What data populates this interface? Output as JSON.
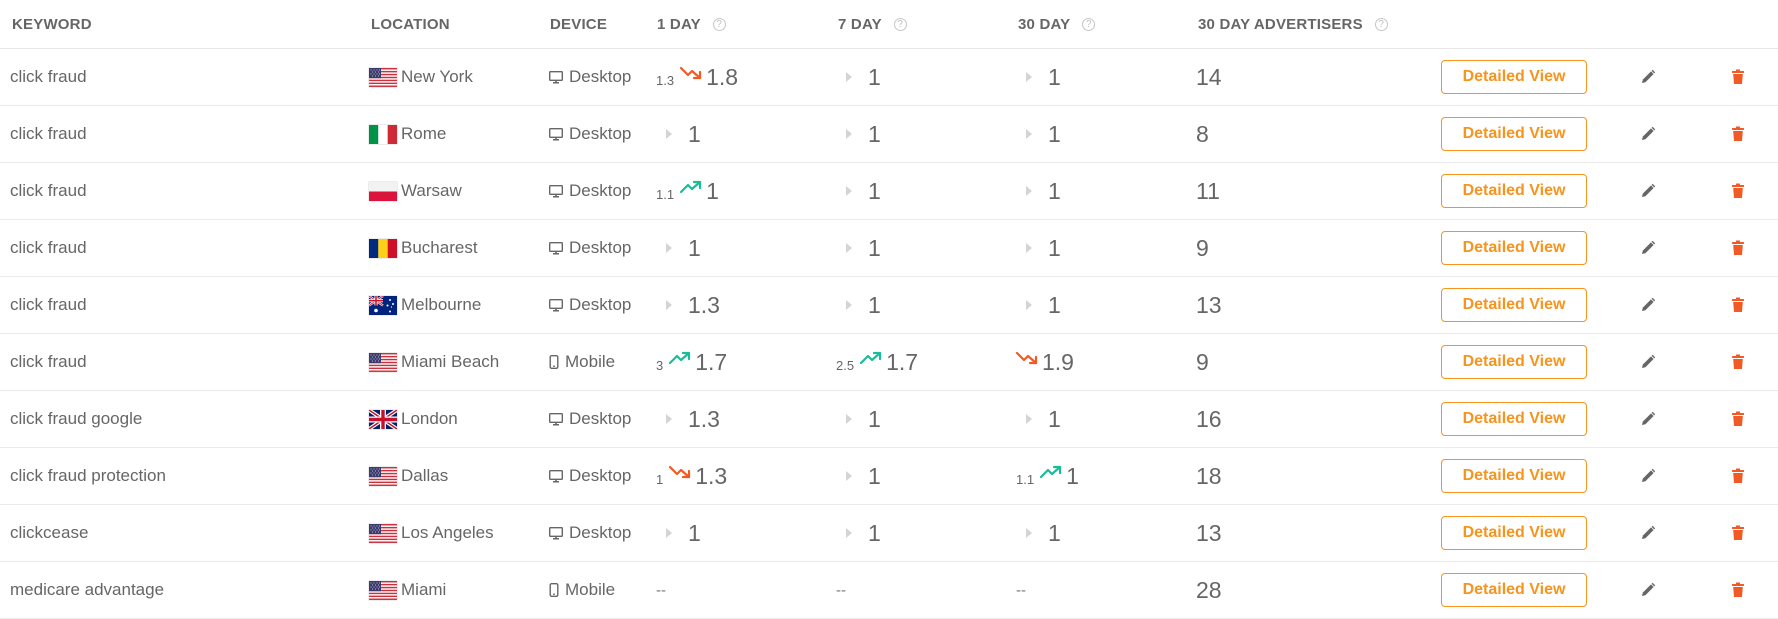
{
  "columns": {
    "keyword": "KEYWORD",
    "location": "LOCATION",
    "device": "DEVICE",
    "day1": "1 DAY",
    "day7": "7 DAY",
    "day30": "30 DAY",
    "advertisers": "30 DAY ADVERTISERS",
    "help_glyph": "?"
  },
  "colors": {
    "accent": "#f7941d",
    "trend_up": "#1abc9c",
    "trend_down": "#f15a24",
    "delete": "#f15a24"
  },
  "detail_label": "Detailed View",
  "rows": [
    {
      "keyword": "click fraud",
      "location": "New York",
      "flag": "us",
      "device": "Desktop",
      "device_icon": "desktop-icon",
      "d1": {
        "type": "change",
        "prev": "1.3",
        "dir": "down",
        "cur": "1.8"
      },
      "d7": {
        "type": "same",
        "cur": "1"
      },
      "d30": {
        "type": "same",
        "cur": "1"
      },
      "advertisers": "14"
    },
    {
      "keyword": "click fraud",
      "location": "Rome",
      "flag": "it",
      "device": "Desktop",
      "device_icon": "desktop-icon",
      "d1": {
        "type": "same",
        "cur": "1"
      },
      "d7": {
        "type": "same",
        "cur": "1"
      },
      "d30": {
        "type": "same",
        "cur": "1"
      },
      "advertisers": "8"
    },
    {
      "keyword": "click fraud",
      "location": "Warsaw",
      "flag": "pl",
      "device": "Desktop",
      "device_icon": "desktop-icon",
      "d1": {
        "type": "change",
        "prev": "1.1",
        "dir": "up",
        "cur": "1"
      },
      "d7": {
        "type": "same",
        "cur": "1"
      },
      "d30": {
        "type": "same",
        "cur": "1"
      },
      "advertisers": "11"
    },
    {
      "keyword": "click fraud",
      "location": "Bucharest",
      "flag": "ro",
      "device": "Desktop",
      "device_icon": "desktop-icon",
      "d1": {
        "type": "same",
        "cur": "1"
      },
      "d7": {
        "type": "same",
        "cur": "1"
      },
      "d30": {
        "type": "same",
        "cur": "1"
      },
      "advertisers": "9"
    },
    {
      "keyword": "click fraud",
      "location": "Melbourne",
      "flag": "au",
      "device": "Desktop",
      "device_icon": "desktop-icon",
      "d1": {
        "type": "same",
        "cur": "1.3"
      },
      "d7": {
        "type": "same",
        "cur": "1"
      },
      "d30": {
        "type": "same",
        "cur": "1"
      },
      "advertisers": "13"
    },
    {
      "keyword": "click fraud",
      "location": "Miami Beach",
      "flag": "us",
      "device": "Mobile",
      "device_icon": "mobile-icon",
      "d1": {
        "type": "change",
        "prev": "3",
        "dir": "up",
        "cur": "1.7"
      },
      "d7": {
        "type": "change",
        "prev": "2.5",
        "dir": "up",
        "cur": "1.7"
      },
      "d30": {
        "type": "change",
        "prev": "",
        "dir": "down",
        "cur": "1.9"
      },
      "advertisers": "9"
    },
    {
      "keyword": "click fraud google",
      "location": "London",
      "flag": "gb",
      "device": "Desktop",
      "device_icon": "desktop-icon",
      "d1": {
        "type": "same",
        "cur": "1.3"
      },
      "d7": {
        "type": "same",
        "cur": "1"
      },
      "d30": {
        "type": "same",
        "cur": "1"
      },
      "advertisers": "16"
    },
    {
      "keyword": "click fraud protection",
      "location": "Dallas",
      "flag": "us",
      "device": "Desktop",
      "device_icon": "desktop-icon",
      "d1": {
        "type": "change",
        "prev": "1",
        "dir": "down",
        "cur": "1.3"
      },
      "d7": {
        "type": "same",
        "cur": "1"
      },
      "d30": {
        "type": "change",
        "prev": "1.1",
        "dir": "up",
        "cur": "1"
      },
      "advertisers": "18"
    },
    {
      "keyword": "clickcease",
      "location": "Los Angeles",
      "flag": "us",
      "device": "Desktop",
      "device_icon": "desktop-icon",
      "d1": {
        "type": "same",
        "cur": "1"
      },
      "d7": {
        "type": "same",
        "cur": "1"
      },
      "d30": {
        "type": "same",
        "cur": "1"
      },
      "advertisers": "13"
    },
    {
      "keyword": "medicare advantage",
      "location": "Miami",
      "flag": "us",
      "device": "Mobile",
      "device_icon": "mobile-icon",
      "d1": {
        "type": "none",
        "cur": "--"
      },
      "d7": {
        "type": "none",
        "cur": "--"
      },
      "d30": {
        "type": "none",
        "cur": "--"
      },
      "advertisers": "28"
    }
  ]
}
